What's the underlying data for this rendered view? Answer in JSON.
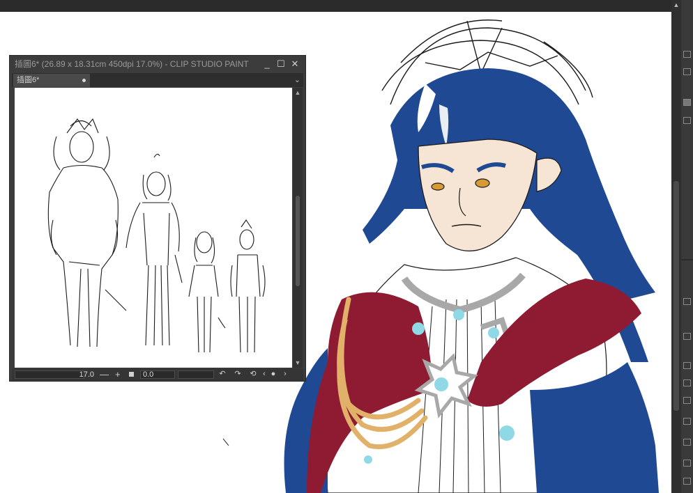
{
  "navigator": {
    "title": "插圖6* (26.89 x 18.31cm 450dpi 17.0%)  - CLIP STUDIO PAINT",
    "tab_label": "插圖6*",
    "zoom_value": "17.0",
    "rotate_value": "0.0",
    "icons": {
      "minimize": "minimize-icon",
      "maximize": "maximize-icon",
      "close": "close-icon",
      "zoom_out": "minus-icon",
      "zoom_in": "plus-icon",
      "fit": "square-icon",
      "rotate_left": "rotate-left-icon",
      "rotate_right": "rotate-right-icon",
      "reset_rotation": "reset-rotation-icon",
      "flip_left": "chevron-left-icon",
      "flip_right": "chevron-right-icon"
    },
    "glyphs": {
      "minimize": "_",
      "maximize": "☐",
      "close": "✕",
      "minus": "—",
      "plus": "+",
      "rot_left": "↶",
      "rot_right": "↷",
      "reset": "⟲",
      "left": "‹",
      "right": "›",
      "chev": "⌄"
    }
  },
  "colors": {
    "hair_blue": "#1f4a93",
    "cape_red": "#8e1b32",
    "gold_cord": "#e1b16a",
    "gem_cyan": "#8fd8e6",
    "skin": "#f6e4d4",
    "ui_dark": "#2b2b2b"
  }
}
